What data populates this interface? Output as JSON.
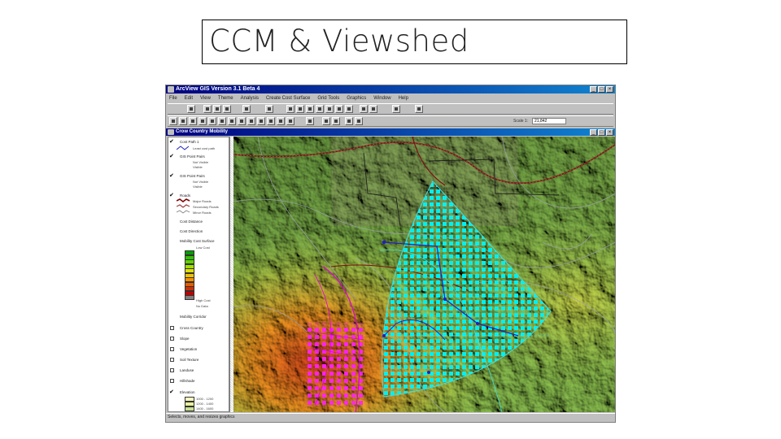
{
  "slide": {
    "title": "CCM & Viewshed"
  },
  "app": {
    "title": "ArcView GIS Version 3.1 Beta 4",
    "menus": [
      "File",
      "Edit",
      "View",
      "Theme",
      "Analysis",
      "Create Cost Surface",
      "Grid Tools",
      "Graphics",
      "Window",
      "Help"
    ],
    "scale_label": "Scale 1:",
    "scale_value": "21,842"
  },
  "view": {
    "title": "Crow Country Mobility",
    "themes": [
      {
        "name": "Cost Path 1",
        "checked": true,
        "sub": [
          "Least cost path"
        ]
      },
      {
        "name": "GIS Point Pairs",
        "checked": true,
        "sub": [
          "Not Visible",
          "Visible"
        ]
      },
      {
        "name": "GIS Point Pairs",
        "checked": true,
        "sub": [
          "Not Visible",
          "Visible"
        ]
      },
      {
        "name": "Roads",
        "checked": true,
        "sub": [
          "Major Roads",
          "Secondary Roads",
          "Minor Roads"
        ]
      },
      {
        "name": "Cost Distance",
        "checked": false,
        "sub": []
      },
      {
        "name": "Cost Direction",
        "checked": false,
        "sub": []
      },
      {
        "name": "Mobility Cost Surface",
        "checked": false,
        "sub": [
          "Low Cost",
          "High Cost",
          "No Data"
        ]
      },
      {
        "name": "Mobility Corridor",
        "checked": false,
        "sub": []
      },
      {
        "name": "Cross Country",
        "checked": false,
        "sub": []
      },
      {
        "name": "Slope",
        "checked": false,
        "sub": []
      },
      {
        "name": "Vegetation",
        "checked": false,
        "sub": []
      },
      {
        "name": "Soil Texture",
        "checked": false,
        "sub": []
      },
      {
        "name": "Landuse",
        "checked": false,
        "sub": []
      },
      {
        "name": "Hillshade",
        "checked": false,
        "sub": []
      },
      {
        "name": "Elevation",
        "checked": true,
        "sub": [
          "1000 - 1200",
          "1200 - 1400",
          "1400 - 1600"
        ]
      }
    ],
    "cost_colors": [
      "#00a000",
      "#30c000",
      "#60d000",
      "#a0e000",
      "#e0e000",
      "#f0c000",
      "#f09000",
      "#e06000",
      "#d03000",
      "#c00000",
      "#808080"
    ],
    "elev_colors": [
      "#f8f8c0",
      "#e8f0a0",
      "#c8e090"
    ]
  },
  "status": {
    "text": "Selects, moves, and resizes graphics"
  }
}
